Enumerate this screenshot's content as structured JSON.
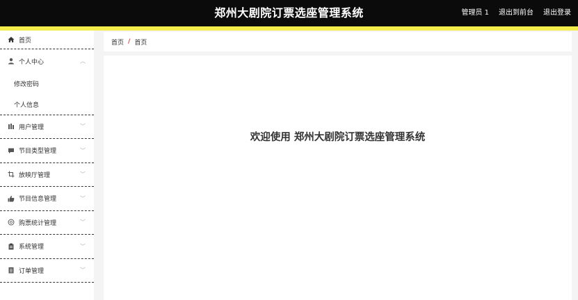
{
  "header": {
    "title": "郑州大剧院订票选座管理系统",
    "user": "管理员 1",
    "back_to_front": "退出到前台",
    "logout": "退出登录"
  },
  "sidebar": {
    "home": "首页",
    "personal": "个人中心",
    "change_password": "修改密码",
    "personal_info": "个人信息",
    "items": [
      {
        "label": "用户管理",
        "icon": "users-icon"
      },
      {
        "label": "节目类型管理",
        "icon": "chat-icon"
      },
      {
        "label": "放映厅管理",
        "icon": "crop-icon"
      },
      {
        "label": "节目信息管理",
        "icon": "thumbs-up-icon"
      },
      {
        "label": "购票统计管理",
        "icon": "circle-icon"
      },
      {
        "label": "系统管理",
        "icon": "clipboard-icon"
      },
      {
        "label": "订单管理",
        "icon": "list-icon"
      }
    ]
  },
  "breadcrumb": {
    "root": "首页",
    "separator": "/",
    "current": "首页"
  },
  "main": {
    "welcome": "欢迎使用 郑州大剧院订票选座管理系统"
  },
  "colors": {
    "topbar": "#0b0b0b",
    "accent": "#f5ee4a",
    "breadcrumb_separator": "#d43c3c"
  }
}
